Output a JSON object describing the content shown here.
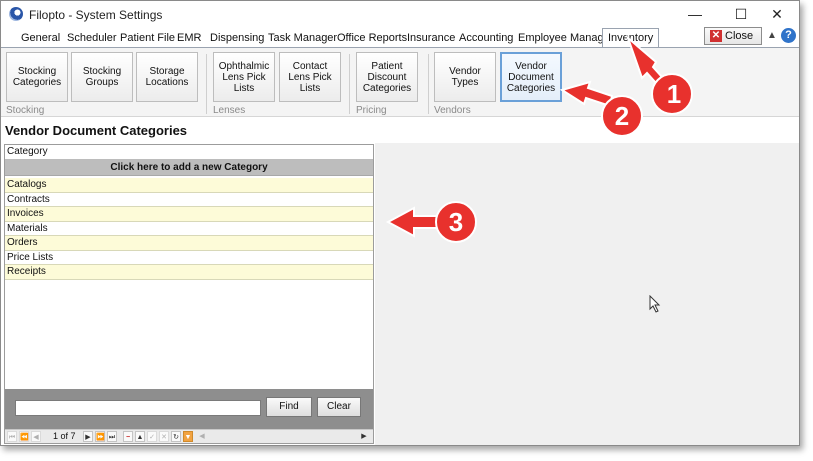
{
  "window": {
    "title": "Filopto - System Settings"
  },
  "controls": {
    "minimize": "—",
    "maximize": "☐",
    "close": "✕"
  },
  "tabs": [
    {
      "label": "General"
    },
    {
      "label": "Scheduler"
    },
    {
      "label": "Patient File"
    },
    {
      "label": "EMR"
    },
    {
      "label": "Dispensing"
    },
    {
      "label": "Task Manager"
    },
    {
      "label": "Office Reports"
    },
    {
      "label": "Insurance"
    },
    {
      "label": "Accounting"
    },
    {
      "label": "Employee Manager"
    },
    {
      "label": "Inventory",
      "active": true
    }
  ],
  "header_buttons": {
    "close_label": "Close"
  },
  "ribbon": {
    "buttons": {
      "stocking_categories": "Stocking Categories",
      "stocking_groups": "Stocking Groups",
      "storage_locations": "Storage Locations",
      "ophthalmic_lens_pick_lists": "Ophthalmic Lens Pick Lists",
      "contact_lens_pick_lists": "Contact Lens Pick Lists",
      "patient_discount_categories": "Patient Discount Categories",
      "vendor_types": "Vendor Types",
      "vendor_document_categories": "Vendor Document Categories"
    },
    "groups": {
      "stocking": "Stocking",
      "lenses": "Lenses",
      "pricing": "Pricing",
      "vendors": "Vendors"
    }
  },
  "content": {
    "title": "Vendor Document Categories",
    "grid": {
      "column_header": "Category",
      "add_row_label": "Click here to add a new Category",
      "rows": [
        "Catalogs",
        "Contracts",
        "Invoices",
        "Materials",
        "Orders",
        "Price Lists",
        "Receipts"
      ]
    },
    "find": {
      "input_value": "",
      "find_label": "Find",
      "clear_label": "Clear"
    },
    "pager": {
      "indicator": "1 of 7"
    }
  },
  "callouts": {
    "one": "1",
    "two": "2",
    "three": "3"
  },
  "colors": {
    "callout_red": "#e8312d",
    "row_highlight": "#fdfbd8",
    "selected_border": "#6aa0d8"
  }
}
